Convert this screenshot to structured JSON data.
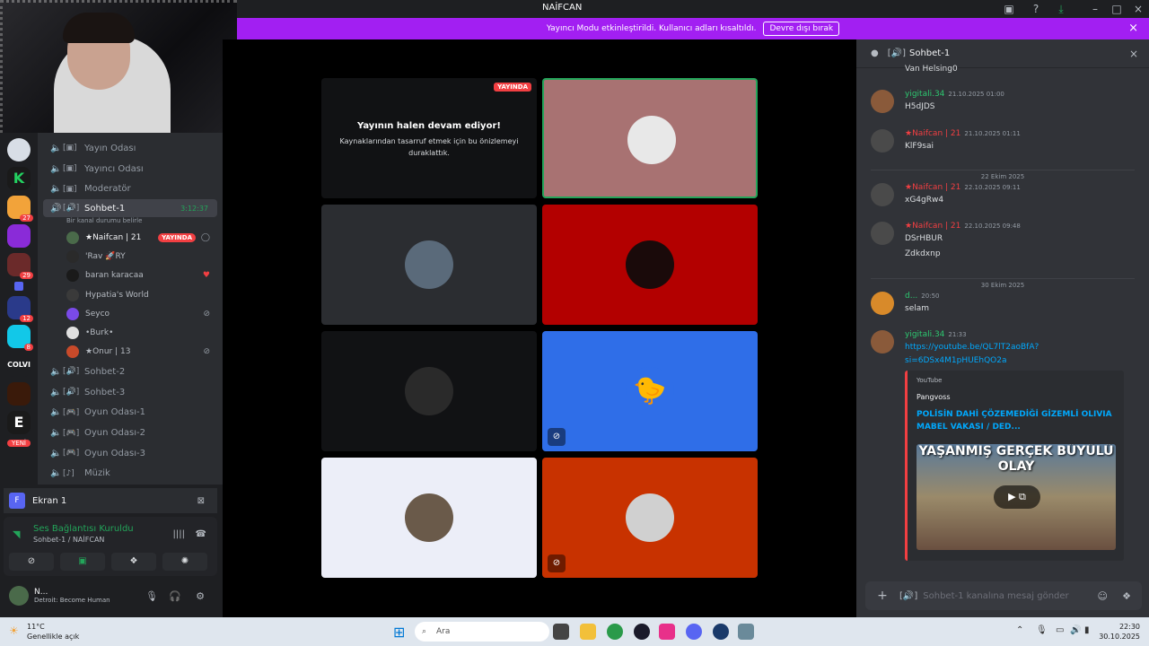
{
  "titlebar": {
    "title": "NAİFCAN"
  },
  "banner": {
    "text": "Yayıncı Modu etkinleştirildi. Kullanıcı adları kısaltıldı.",
    "button": "Devre dışı bırak"
  },
  "guilds": {
    "badges": [
      "27",
      "29",
      "12",
      "8"
    ],
    "new_label": "YENİ",
    "colvi_label": "COLVI"
  },
  "channels": [
    {
      "name": "Yayın Odası"
    },
    {
      "name": "Yayıncı Odası"
    },
    {
      "name": "Moderatör"
    }
  ],
  "active_channel": {
    "name": "Sohbet-1",
    "time": "3:12:37",
    "status": "Bir kanal durumu belirle"
  },
  "voice_users": [
    {
      "name": "★Naifcan | 21",
      "live": "YAYINDA"
    },
    {
      "name": "'Rav 🚀RY"
    },
    {
      "name": "baran karacaa"
    },
    {
      "name": "Hypatia's World"
    },
    {
      "name": "Seyco"
    },
    {
      "name": "•Burk•"
    },
    {
      "name": "★Onur | 13"
    }
  ],
  "channels_after": [
    {
      "name": "Sohbet-2"
    },
    {
      "name": "Sohbet-3"
    },
    {
      "name": "Oyun Odası-1"
    },
    {
      "name": "Oyun Odası-2"
    },
    {
      "name": "Oyun Odası-3"
    },
    {
      "name": "Müzik"
    }
  ],
  "screen_share": {
    "label": "Ekran 1"
  },
  "voice_panel": {
    "title": "Ses Bağlantısı Kuruldu",
    "subtitle": "Sohbet-1 / NAİFCAN"
  },
  "user_panel": {
    "name": "N...",
    "activity": "Detroit: Become Human"
  },
  "stage": {
    "streaming_title": "Yayının halen devam ediyor!",
    "streaming_text": "Kaynaklarından tasarruf etmek için bu önizlemeyi duraklattık.",
    "live_label": "YAYINDA"
  },
  "chat": {
    "header": "Sohbet-1",
    "top_text": "Van Helsing0",
    "messages": [
      {
        "author": "yigitali.34",
        "time": "21.10.2025 01:00",
        "text": "H5dJDS",
        "color": "#2dc770"
      },
      {
        "author": "★Naifcan | 21",
        "time": "21.10.2025 01:11",
        "text": "KlF9sai",
        "color": "#f23f42"
      },
      {
        "author": "★Naifcan | 21",
        "time": "22.10.2025 09:11",
        "text": "xG4gRw4",
        "color": "#f23f42"
      },
      {
        "author": "★Naifcan | 21",
        "time": "22.10.2025 09:48",
        "text": "DSrHBUR",
        "text2": "Zdkdxnp",
        "color": "#f23f42"
      },
      {
        "author": "d...",
        "time": "20:50",
        "text": "selam",
        "color": "#2dc770"
      },
      {
        "author": "yigitali.34",
        "time": "21:33",
        "text": "https://youtube.be/QL7lT2aoBfA?",
        "text2": "si=6DSx4M1pHUEhQO2a",
        "color": "#2dc770"
      }
    ],
    "dividers": [
      "22 Ekim 2025",
      "30 Ekim 2025"
    ],
    "embed": {
      "provider": "YouTube",
      "author": "Pangvoss",
      "title": "POLİSİN DAHİ ÇÖZEMEDİĞİ GİZEMLİ OLIVIA MABEL VAKASI / DED...",
      "thumb_text": "YAŞANMIŞ GERÇEK BÜYÜLÜ OLAY"
    },
    "input_placeholder": "Sohbet-1 kanalına mesaj gönder"
  },
  "taskbar": {
    "temp": "11°C",
    "weather": "Genellikle açık",
    "search": "Ara",
    "time": "22:30",
    "date": "30.10.2025"
  }
}
